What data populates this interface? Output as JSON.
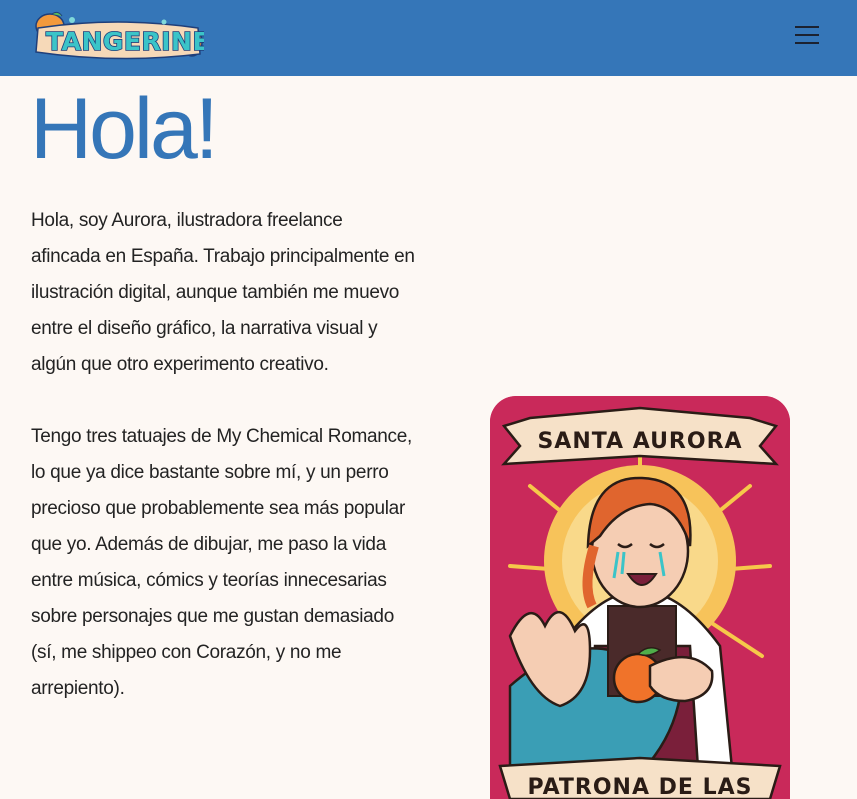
{
  "header": {
    "logo_text": "TANGERINE",
    "menu_icon": "hamburger-menu-icon",
    "background_color": "#3576b8"
  },
  "main": {
    "title": "Hola!",
    "paragraphs": [
      "Hola, soy Aurora, ilustradora freelance afincada en España. Trabajo principalmente en ilustración digital, aunque también me muevo entre el diseño gráfico, la narrativa visual y algún que otro experimento creativo.",
      "Tengo tres tatuajes de My Chemical Romance, lo que ya dice bastante sobre mí, y un perro precioso que probablemente sea más popular que yo. Además de dibujar, me paso la vida entre música, cómics y teorías innecesarias sobre personajes que me gustan demasiado (sí, me shippeo con Corazón, y no me arrepiento)."
    ],
    "illustration": {
      "top_banner": "SANTA AURORA",
      "bottom_banner": "PATRONA DE LAS"
    }
  },
  "colors": {
    "accent": "#3576b8",
    "page_background": "#fdf8f4",
    "card_background": "#c9295a",
    "text": "#232323"
  }
}
